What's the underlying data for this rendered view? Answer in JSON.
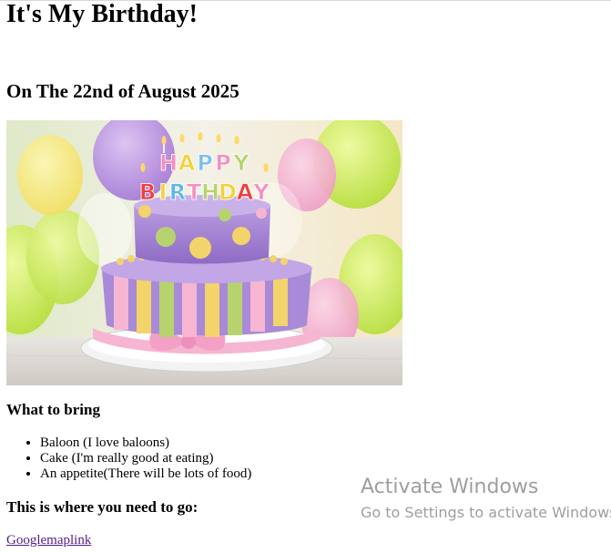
{
  "page": {
    "title": "It's My Birthday!",
    "date_heading": "On The 22nd of August 2025",
    "bring_heading": "What to bring",
    "bring_items": [
      "Baloon (I love baloons)",
      "Cake (I'm really good at eating)",
      "An appetite(There will be lots of food)"
    ],
    "go_heading": "This is where you need to go:",
    "map_link_text": "Googlemaplink"
  },
  "image": {
    "alt": "Happy Birthday cake"
  },
  "cake_letters": {
    "happy": "HAPPY",
    "birthday": "BIRTHDAY"
  },
  "watermark": {
    "title": "Activate Windows",
    "subtitle": "Go to Settings to activate Windows."
  }
}
